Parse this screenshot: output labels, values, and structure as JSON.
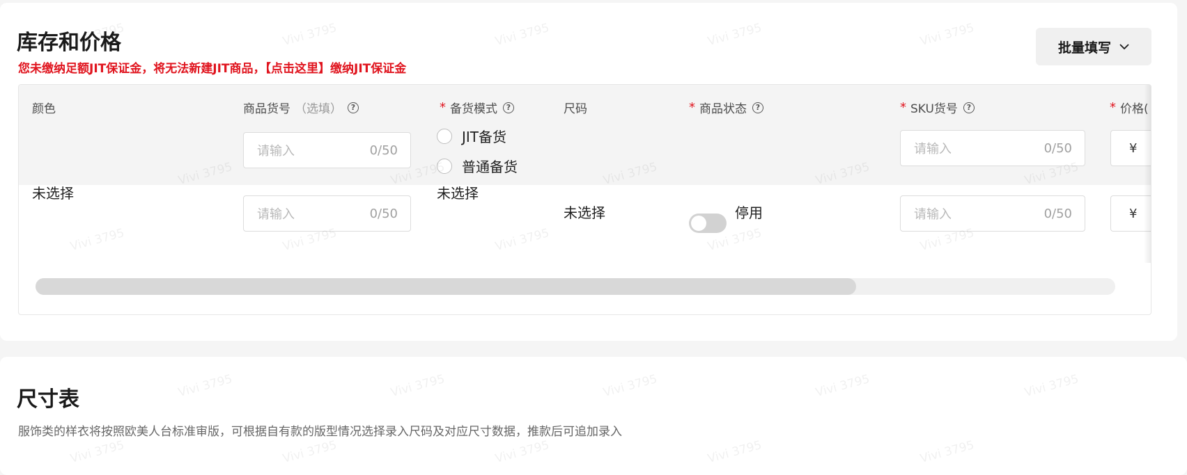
{
  "inventory": {
    "title": "库存和价格",
    "warning": "您未缴纳足额JIT保证金，将无法新建JIT商品，【点击这里】缴纳JIT保证金",
    "bulk_button": "批量填写",
    "headers": {
      "color": "颜色",
      "item_no": "商品货号",
      "item_no_optional": "（选填）",
      "stock_mode": "备货模式",
      "size": "尺码",
      "status": "商品状态",
      "sku": "SKU货号",
      "price": "价格("
    },
    "required_mark": "*",
    "help_glyph": "?",
    "header_inputs": {
      "item_no_placeholder": "请输入",
      "item_no_count": "0/50",
      "sku_placeholder": "请输入",
      "sku_count": "0/50",
      "price_symbol": "¥"
    },
    "stock_mode_options": [
      "JIT备货",
      "普通备货"
    ],
    "row": {
      "color": "未选择",
      "item_no_placeholder": "请输入",
      "item_no_count": "0/50",
      "stock_mode": "未选择",
      "size": "未选择",
      "status_label": "停用",
      "status_on": false,
      "sku_placeholder": "请输入",
      "sku_count": "0/50",
      "price_symbol": "¥"
    },
    "scroll_fraction": 0.76
  },
  "size_chart": {
    "title": "尺寸表",
    "description": "服饰类的样衣将按照欧美人台标准审版，可根据自有款的版型情况选择录入尺码及对应尺寸数据，推款后可追加录入"
  },
  "watermark": "Vivi 3795"
}
